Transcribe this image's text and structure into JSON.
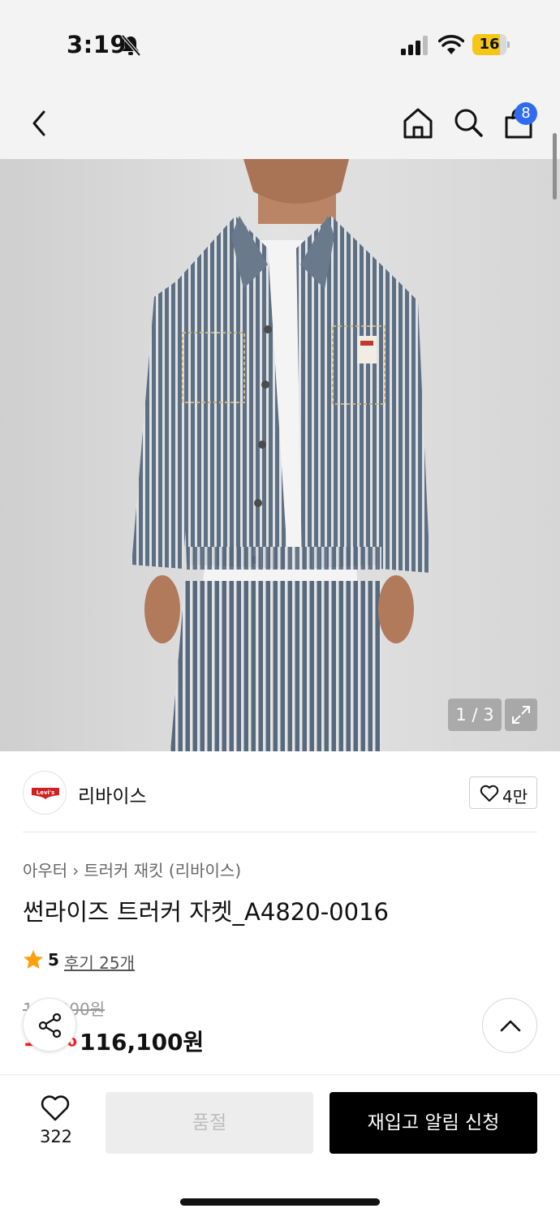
{
  "status_bar": {
    "time": "3:19",
    "battery": "16"
  },
  "nav": {
    "cart_count": "8"
  },
  "hero": {
    "image_counter": "1 / 3"
  },
  "brand": {
    "logo_text": "Levi's",
    "name": "리바이스",
    "likes": "4만"
  },
  "product": {
    "breadcrumb": [
      "아우터",
      "트러커 재킷 (리바이스)"
    ],
    "title": "썬라이즈 트러커 자켓_A4820-0016",
    "rating": "5",
    "reviews": "후기 25개",
    "original_price": "129,000원",
    "discount_rate": "10%",
    "sale_price": "116,100원"
  },
  "bottom_bar": {
    "wish_count": "322",
    "sold_out_label": "품절",
    "restock_label": "재입고 알림 신청"
  },
  "colors": {
    "accent_red": "#ff1d1d",
    "badge_blue": "#2f6bf2",
    "battery_yellow": "#f5c518"
  }
}
